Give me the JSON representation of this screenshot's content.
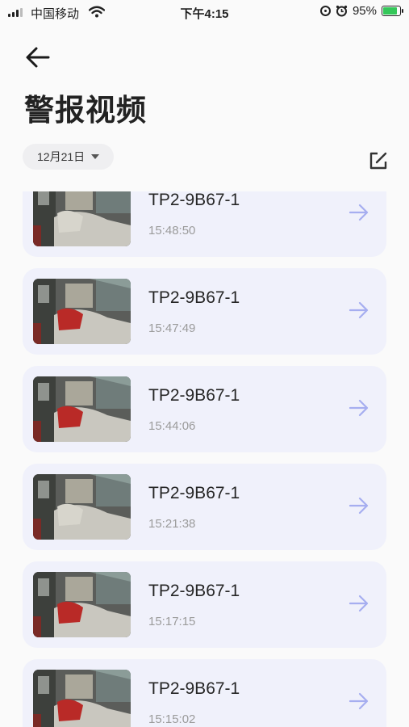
{
  "status_bar": {
    "carrier": "中国移动",
    "time": "下午4:15",
    "battery": "95%"
  },
  "header": {
    "back_icon": "arrow-left-icon",
    "title": "警报视频",
    "date_filter": "12月21日",
    "edit_icon": "edit-icon"
  },
  "alerts": [
    {
      "device": "TP2-9B67-1",
      "time": "15:48:50"
    },
    {
      "device": "TP2-9B67-1",
      "time": "15:47:49"
    },
    {
      "device": "TP2-9B67-1",
      "time": "15:44:06"
    },
    {
      "device": "TP2-9B67-1",
      "time": "15:21:38"
    },
    {
      "device": "TP2-9B67-1",
      "time": "15:17:15"
    },
    {
      "device": "TP2-9B67-1",
      "time": "15:15:02"
    }
  ],
  "colors": {
    "card_bg": "#f0f1fb",
    "arrow": "#a6aef0",
    "battery_fill": "#34c759"
  }
}
